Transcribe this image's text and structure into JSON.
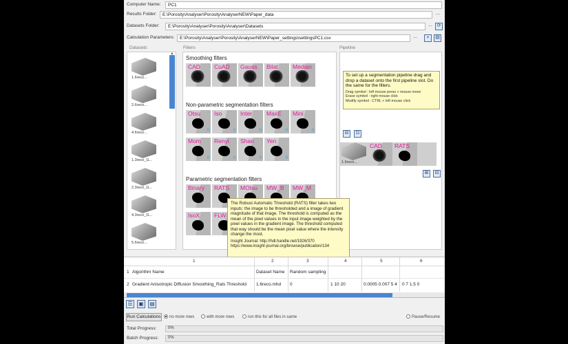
{
  "form": {
    "computer_name_label": "Computer Name:",
    "computer_name_value": "PC1",
    "results_folder_label": "Results Folder:",
    "results_folder_value": "E:\\Porosity\\Analyser\\Porosity\\AnalyserNEW\\Paper_data",
    "dataset_folder_label": "Datasets Folder:",
    "dataset_folder_value": "E:\\Porosity\\Analyser\\Porosity\\Analyser\\Datasets",
    "calc_params_label": "Calculation Parameters:",
    "calc_params_value": "E:\\Porosity\\Analyser\\Porosity\\AnalyserNEW\\Paper_settings\\settingsPC1.csv",
    "browse_label": "..."
  },
  "panels": {
    "datasets_header": "Datasets",
    "filters_header": "Filters",
    "pipeline_header": "Pipeline"
  },
  "datasets": [
    {
      "label": "1.6reco..."
    },
    {
      "label": "2.6reco..."
    },
    {
      "label": "4.6reco..."
    },
    {
      "label": "1.3reco_G..."
    },
    {
      "label": "2.3reco_G..."
    },
    {
      "label": "4.3reco_G..."
    },
    {
      "label": "5.6reco..."
    }
  ],
  "filters": {
    "smoothing_title": "Smoothing filters",
    "smoothing": [
      "CAD",
      "CuAD",
      "Gauss",
      "Bilat",
      "Median"
    ],
    "nonparam_title": "Non-parametric segmentation filters",
    "nonparam": [
      {
        "name": "Otsu",
        "num": "0"
      },
      {
        "name": "Iso",
        "num": "0"
      },
      {
        "name": "Inter",
        "num": "0"
      },
      {
        "name": "MaxE",
        "num": "0"
      },
      {
        "name": "Mini",
        "num": "0"
      },
      {
        "name": "Mom",
        "num": "0"
      },
      {
        "name": "Renyi",
        "num": "0"
      },
      {
        "name": "Shan",
        "num": "0"
      },
      {
        "name": "Yen",
        "num": "0"
      }
    ],
    "param_title": "Parametric segmentation filters",
    "param": [
      "Binary",
      "RATS",
      "MOtsu",
      "MW_B",
      "MW_M",
      "IsoX",
      "FLW"
    ]
  },
  "pipeline": {
    "hint_title": "To set up a segmentation pipeline drag and drop a dataset onto the first pipeline slot. Do the same for the filters.",
    "hint_lines": [
      "Drag symbol  : left mouse press + mouse move",
      "Erase symbol : right mouse click",
      "Modify symbol : CTRL + left mouse click"
    ],
    "dataset_label": "1.6reco...",
    "slot1": "CAD",
    "slot2": "RATS"
  },
  "tooltip": {
    "body": "The Robust Automatic Threshold (RATS) filter takes two inputs: the image to be thresholded and a image of gradient magnitude of that image. The threshold is computed as the mean of the pixel values in the input image weighted by the pixel values in the gradient image. The threshold computed that way should be the mean pixel value where the intensity change the most.",
    "link": "Insight Journal: http://hdl.handle.net/1926/370 https://www.insight-journal.org/browse/publication/134"
  },
  "table": {
    "col_headers": [
      "1",
      "2",
      "3",
      "4",
      "5",
      "6"
    ],
    "row1": [
      "1",
      "Algorithm Name",
      "Dataset Name",
      "Random sampling",
      "",
      "",
      ""
    ],
    "row2": [
      "2",
      "Gradient Anisotropic Diffusion Smoothing_Rats Threshold",
      "1.6reco.mhd",
      "0",
      "1 10 20",
      "0.0005 0.007 5 4",
      "0 7 1.5 0"
    ]
  },
  "controls": {
    "run_label": "Run Calculations",
    "radio1": "no more rows",
    "radio2": "with more rows",
    "radio3": "run this for all files in same",
    "pause_label": "Pause/Resume",
    "total_label": "Total Progress:",
    "total_value": "0%",
    "total_fraction": 0,
    "batch_label": "Batch Progress:",
    "batch_value": "0%",
    "batch_fraction": 0
  },
  "colors": {
    "accent": "#4a86cf",
    "filter_label": "#e2189b",
    "tooltip_bg": "#fffbc6"
  }
}
